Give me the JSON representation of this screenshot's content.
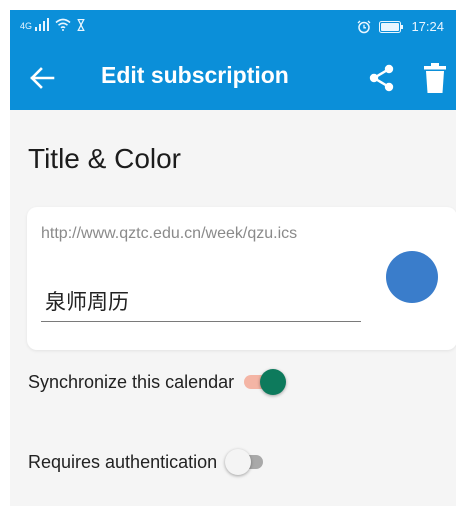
{
  "status_bar": {
    "network_label": "4G",
    "time": "17:24",
    "icons": [
      "signal-icon",
      "wifi-icon",
      "hourglass-icon",
      "alarm-icon",
      "battery-icon"
    ]
  },
  "app_bar": {
    "title": "Edit subscription",
    "back_icon": "arrow-back-icon",
    "share_icon": "share-icon",
    "delete_icon": "trash-icon"
  },
  "section": {
    "title": "Title & Color"
  },
  "subscription": {
    "url": "http://www.qztc.edu.cn/week/qzu.ics",
    "name": "泉师周历",
    "color": "#3a7dcb"
  },
  "settings": {
    "sync": {
      "label": "Synchronize this calendar",
      "enabled": true
    },
    "auth": {
      "label": "Requires authentication",
      "enabled": false
    }
  },
  "colors": {
    "primary": "#0b8fd9",
    "switch_on_thumb": "#0d7a5c",
    "switch_on_track": "#f4b5a5",
    "switch_off_thumb": "#f4f4f4",
    "switch_off_track": "#a9a9a9"
  }
}
